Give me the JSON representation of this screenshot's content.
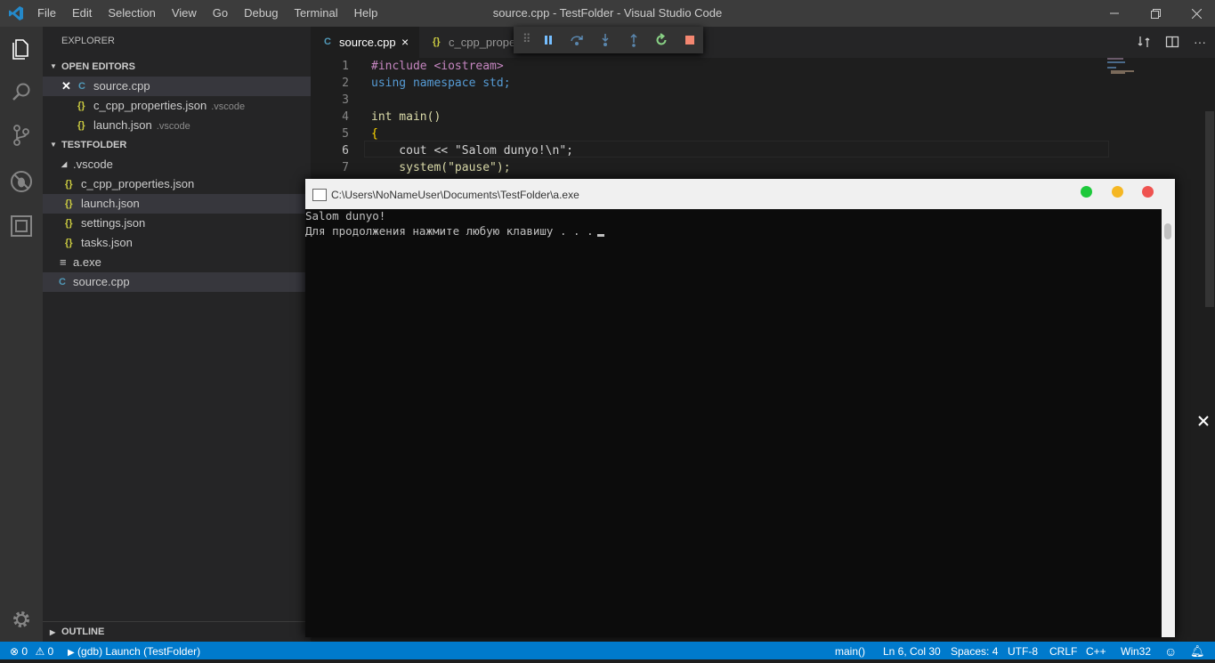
{
  "menubar": [
    "File",
    "Edit",
    "Selection",
    "View",
    "Go",
    "Debug",
    "Terminal",
    "Help"
  ],
  "window_title": "source.cpp - TestFolder - Visual Studio Code",
  "explorer": {
    "title": "EXPLORER",
    "open_editors": {
      "header": "OPEN EDITORS",
      "items": [
        {
          "icon": "cpp-icon",
          "name": "source.cpp",
          "path": ""
        },
        {
          "icon": "json-icon",
          "name": "c_cpp_properties.json",
          "path": ".vscode"
        },
        {
          "icon": "json-icon",
          "name": "launch.json",
          "path": ".vscode"
        }
      ]
    },
    "folder": {
      "header": "TESTFOLDER",
      "items": [
        {
          "name": ".vscode"
        },
        {
          "name": "c_cpp_properties.json"
        },
        {
          "name": "launch.json"
        },
        {
          "name": "settings.json"
        },
        {
          "name": "tasks.json"
        },
        {
          "name": "a.exe"
        },
        {
          "name": "source.cpp"
        }
      ]
    },
    "outline_header": "OUTLINE"
  },
  "tabs": [
    {
      "label": "source.cpp",
      "close": "×"
    },
    {
      "label": "c_cpp_prope"
    }
  ],
  "code_lines": [
    {
      "n": "1",
      "text": "#include <iostream>"
    },
    {
      "n": "2",
      "text": "using namespace std;"
    },
    {
      "n": "3",
      "text": ""
    },
    {
      "n": "4",
      "text": "int main()"
    },
    {
      "n": "5",
      "text": "{"
    },
    {
      "n": "6",
      "text": "    cout << \"Salom dunyo!\\n\";"
    },
    {
      "n": "7",
      "text": "    system(\"pause\");"
    }
  ],
  "console": {
    "title": "C:\\Users\\NoNameUser\\Documents\\TestFolder\\a.exe",
    "lines": [
      "Salom dunyo!",
      "Для продолжения нажмите любую клавишу . . ."
    ]
  },
  "statusbar": {
    "errors": "0",
    "warnings": "0",
    "launch": "(gdb) Launch (TestFolder)",
    "func": "main()",
    "position": "Ln 6, Col 30",
    "spaces": "Spaces: 4",
    "encoding": "UTF-8",
    "eol": "CRLF",
    "language": "C++",
    "platform": "Win32"
  },
  "colors": {
    "statusbar": "#007acc",
    "activitybar": "#333333",
    "sidebar": "#252526",
    "editor": "#1e1e1e"
  }
}
